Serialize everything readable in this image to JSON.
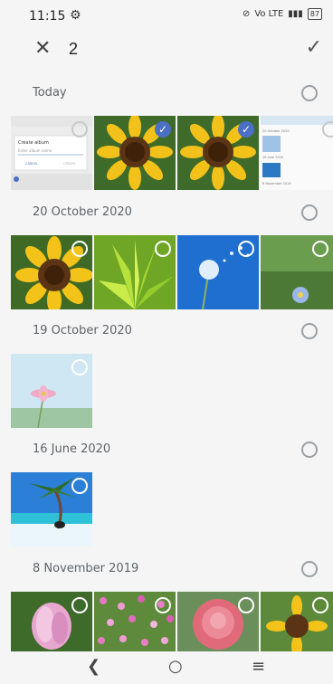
{
  "status_bar": {
    "time": "11:15",
    "network": "Vo LTE",
    "battery": "87"
  },
  "toolbar": {
    "close_icon": "close-icon",
    "selected_count": "2",
    "confirm_icon": "check-icon"
  },
  "sections": [
    {
      "label": "Today",
      "photos": [
        {
          "desc": "screenshot-create-album",
          "selected": false
        },
        {
          "desc": "sunflower",
          "selected": true
        },
        {
          "desc": "sunflower",
          "selected": true
        },
        {
          "desc": "screenshot-gallery",
          "selected": false
        }
      ]
    },
    {
      "label": "20 October 2020",
      "photos": [
        {
          "desc": "sunflower",
          "selected": false
        },
        {
          "desc": "green-plant",
          "selected": false
        },
        {
          "desc": "dandelion",
          "selected": false
        },
        {
          "desc": "daisy",
          "selected": false
        }
      ]
    },
    {
      "label": "19 October 2020",
      "photos": [
        {
          "desc": "cosmos-flower",
          "selected": false
        }
      ]
    },
    {
      "label": "16 June 2020",
      "photos": [
        {
          "desc": "beach-palm",
          "selected": false
        }
      ]
    },
    {
      "label": "8 November 2019",
      "photos": [
        {
          "desc": "magnolia",
          "selected": false
        },
        {
          "desc": "flower-field",
          "selected": false
        },
        {
          "desc": "rose",
          "selected": false
        },
        {
          "desc": "sunflower",
          "selected": false
        }
      ]
    }
  ],
  "screenshot_text": {
    "title": "Create album",
    "placeholder": "Enter album name",
    "cancel": "CANCEL",
    "ok": "CREATE",
    "gallery_label_1": "20 October 2020",
    "gallery_label_2": "16 June 2020",
    "gallery_label_3": "8 November 2019"
  }
}
